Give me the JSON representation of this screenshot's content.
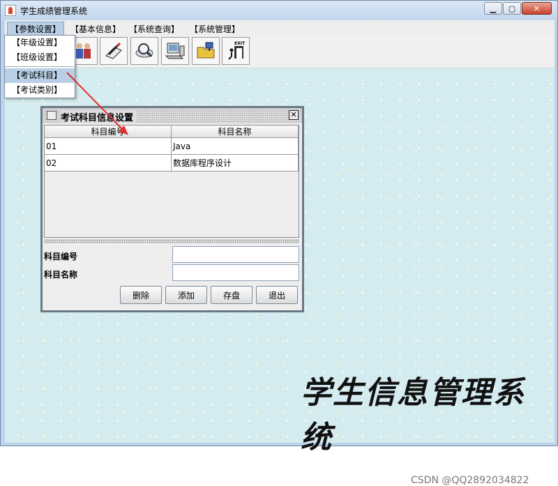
{
  "window": {
    "title": "学生成绩管理系统",
    "min_icon": "minimize-icon",
    "max_icon": "maximize-icon",
    "close_icon": "close-icon"
  },
  "menubar": {
    "items": [
      "【参数设置】",
      "【基本信息】",
      "【系统查询】",
      "【系统管理】"
    ],
    "active_index": 0
  },
  "dropdown": {
    "items": [
      "【年级设置】",
      "【班级设置】",
      "【考试科目】",
      "【考试类别】"
    ],
    "highlighted_index": 2
  },
  "toolbar": {
    "icons": [
      "users-icon",
      "pen-document-icon",
      "magnifier-icon",
      "computer-icon",
      "folder-network-icon",
      "exit-door-icon"
    ],
    "exit_text": "EXIT"
  },
  "subject_window": {
    "title": "考试科目信息设置",
    "columns": [
      "科目编号",
      "科目名称"
    ],
    "rows": [
      {
        "id": "01",
        "name": "Java"
      },
      {
        "id": "02",
        "name": "数据库程序设计"
      }
    ],
    "form": {
      "id_label": "科目编号",
      "id_value": "",
      "name_label": "科目名称",
      "name_value": ""
    },
    "buttons": {
      "delete": "删除",
      "add": "添加",
      "save": "存盘",
      "exit": "退出"
    }
  },
  "slogan": "学生信息管理系统",
  "watermark": "CSDN @QQ2892034822",
  "colors": {
    "desktop_bg": "#d4ebf0",
    "highlight": "#b8cfe5",
    "arrow": "#e03030"
  }
}
